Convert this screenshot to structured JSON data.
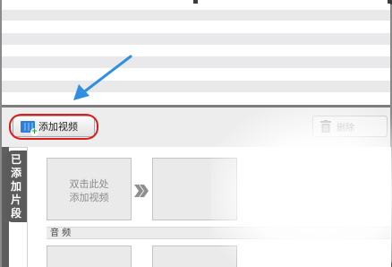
{
  "toolbar": {
    "add_video_label": "添加视频",
    "delete_label": "删除"
  },
  "clips": {
    "side_tab": [
      "已",
      "添",
      "加",
      "片",
      "段"
    ],
    "placeholder_line1": "双击此处",
    "placeholder_line2": "添加视频"
  },
  "audio": {
    "label": "音  频"
  },
  "colors": {
    "highlight_ring": "#d81e1e",
    "arrow": "#2f8fe0",
    "stripe": "#e9e9eb",
    "tab_bg": "#5b5b5b"
  },
  "icons": {
    "add_video": "film-add-icon",
    "delete": "trash-icon",
    "next": "double-chevron-right-icon",
    "pointer": "arrow-annotation-icon"
  }
}
